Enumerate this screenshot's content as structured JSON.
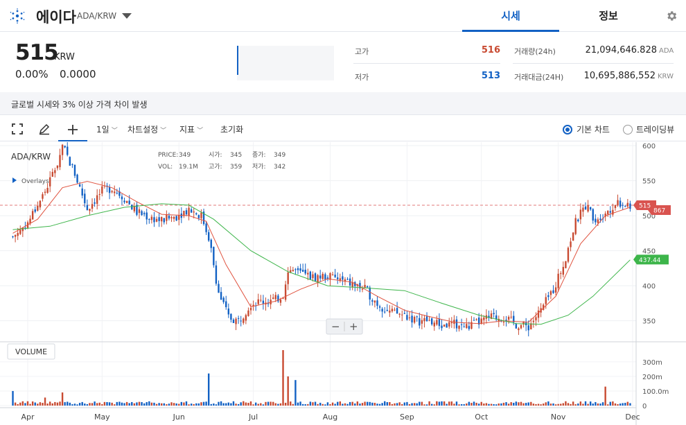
{
  "header": {
    "coin_name": "에이다",
    "pair": "ADA/KRW",
    "tabs": [
      {
        "label": "시세",
        "active": true
      },
      {
        "label": "정보",
        "active": false
      }
    ]
  },
  "summary": {
    "price": "515",
    "unit": "KRW",
    "change_pct": "0.00%",
    "change_abs": "0.0000",
    "high_label": "고가",
    "high_value": "516",
    "low_label": "저가",
    "low_value": "513",
    "volume_label": "거래량(24h)",
    "volume_value": "21,094,646.828",
    "volume_unit": "ADA",
    "turnover_label": "거래대금(24H)",
    "turnover_value": "10,695,886,552",
    "turnover_unit": "KRW",
    "colors": {
      "up": "#c84a31",
      "down": "#1261c4"
    }
  },
  "notice": "글로벌 시세와 3% 이상 가격 차이 발생",
  "toolbar": {
    "interval": "1일",
    "chart_settings": "차트설정",
    "indicators": "지표",
    "reset": "초기화",
    "basic_chart": "기본 차트",
    "tradingview": "트레이딩뷰"
  },
  "chart_info": {
    "symbol": "ADA/KRW",
    "overlays": "Overlays",
    "price_label": "PRICE:",
    "price_value": "349",
    "open_label": "시가:",
    "open_value": "345",
    "close_label": "종가:",
    "close_value": "349",
    "vol_label": "VOL:",
    "vol_value": "19.1M",
    "high_label": "고가:",
    "high_value": "359",
    "low_label": "저가:",
    "low_value": "342",
    "volume_title": "VOLUME",
    "zoom_out": "−",
    "zoom_in": "+"
  },
  "chart_data": {
    "type": "candlestick",
    "x_ticks": [
      "Apr",
      "May",
      "Jun",
      "Jul",
      "Aug",
      "Sep",
      "Oct",
      "Nov",
      "Dec"
    ],
    "y_ticks": [
      "600",
      "550",
      "500",
      "450",
      "400",
      "350"
    ],
    "ylim": [
      320,
      605
    ],
    "volume_ticks": [
      "300m",
      "200m",
      "100.0m",
      "0"
    ],
    "volume_ylim": [
      0,
      380
    ],
    "price_markers": [
      {
        "label": "515",
        "value": 515,
        "color": "#d9534f"
      },
      {
        "label": "867",
        "value": 508,
        "color": "#d9534f"
      },
      {
        "label": "437.44",
        "value": 437.44,
        "color": "#3db54a"
      }
    ],
    "reference_line": 515,
    "close_points": [
      [
        "Mar 26",
        470
      ],
      [
        "Apr 1",
        490
      ],
      [
        "Apr 8",
        535
      ],
      [
        "Apr 13",
        575
      ],
      [
        "Apr 15",
        600
      ],
      [
        "Apr 20",
        560
      ],
      [
        "Apr 25",
        510
      ],
      [
        "May 1",
        535
      ],
      [
        "May 5",
        540
      ],
      [
        "May 10",
        525
      ],
      [
        "May 15",
        505
      ],
      [
        "May 20",
        498
      ],
      [
        "May 25",
        493
      ],
      [
        "May 31",
        500
      ],
      [
        "Jun 5",
        510
      ],
      [
        "Jun 10",
        500
      ],
      [
        "Jun 13",
        470
      ],
      [
        "Jun 17",
        390
      ],
      [
        "Jun 21",
        355
      ],
      [
        "Jun 25",
        350
      ],
      [
        "Jun 30",
        375
      ],
      [
        "Jul 5",
        378
      ],
      [
        "Jul 10",
        380
      ],
      [
        "Jul 13",
        388
      ],
      [
        "Jul 15",
        425
      ],
      [
        "Jul 20",
        418
      ],
      [
        "Jul 25",
        412
      ],
      [
        "Jul 31",
        414
      ],
      [
        "Aug 5",
        408
      ],
      [
        "Aug 10",
        402
      ],
      [
        "Aug 15",
        395
      ],
      [
        "Aug 20",
        375
      ],
      [
        "Aug 25",
        362
      ],
      [
        "Aug 31",
        358
      ],
      [
        "Sep 5",
        350
      ],
      [
        "Sep 10",
        350
      ],
      [
        "Sep 15",
        343
      ],
      [
        "Sep 20",
        345
      ],
      [
        "Sep 25",
        341
      ],
      [
        "Sep 30",
        348
      ],
      [
        "Oct 5",
        355
      ],
      [
        "Oct 10",
        355
      ],
      [
        "Oct 15",
        345
      ],
      [
        "Oct 20",
        342
      ],
      [
        "Oct 25",
        365
      ],
      [
        "Oct 30",
        395
      ],
      [
        "Nov 3",
        430
      ],
      [
        "Nov 8",
        490
      ],
      [
        "Nov 12",
        515
      ],
      [
        "Nov 16",
        495
      ],
      [
        "Nov 20",
        505
      ],
      [
        "Nov 25",
        520
      ],
      [
        "Nov 30",
        515
      ]
    ],
    "ma_short": [
      [
        "Mar 26",
        475
      ],
      [
        "Apr 5",
        495
      ],
      [
        "Apr 15",
        540
      ],
      [
        "Apr 25",
        549
      ],
      [
        "May 5",
        540
      ],
      [
        "May 15",
        520
      ],
      [
        "May 25",
        502
      ],
      [
        "Jun 5",
        500
      ],
      [
        "Jun 12",
        492
      ],
      [
        "Jun 20",
        430
      ],
      [
        "Jun 30",
        370
      ],
      [
        "Jul 10",
        378
      ],
      [
        "Jul 20",
        395
      ],
      [
        "Jul 31",
        410
      ],
      [
        "Aug 10",
        405
      ],
      [
        "Aug 20",
        385
      ],
      [
        "Aug 31",
        365
      ],
      [
        "Sep 10",
        356
      ],
      [
        "Sep 20",
        348
      ],
      [
        "Sep 30",
        346
      ],
      [
        "Oct 10",
        350
      ],
      [
        "Oct 20",
        348
      ],
      [
        "Oct 31",
        385
      ],
      [
        "Nov 10",
        460
      ],
      [
        "Nov 20",
        500
      ],
      [
        "Nov 30",
        512
      ]
    ],
    "ma_long": [
      [
        "Mar 26",
        480
      ],
      [
        "Apr 10",
        485
      ],
      [
        "Apr 25",
        500
      ],
      [
        "May 10",
        512
      ],
      [
        "May 25",
        517
      ],
      [
        "Jun 5",
        515
      ],
      [
        "Jun 15",
        495
      ],
      [
        "Jun 30",
        450
      ],
      [
        "Jul 15",
        420
      ],
      [
        "Jul 31",
        400
      ],
      [
        "Aug 15",
        397
      ],
      [
        "Aug 31",
        393
      ],
      [
        "Sep 15",
        375
      ],
      [
        "Sep 30",
        358
      ],
      [
        "Oct 15",
        346
      ],
      [
        "Oct 25",
        345
      ],
      [
        "Nov 5",
        358
      ],
      [
        "Nov 15",
        385
      ],
      [
        "Nov 30",
        437
      ]
    ],
    "volume_spikes": [
      [
        "Mar 26",
        100
      ],
      [
        "Apr 8",
        55
      ],
      [
        "Apr 15",
        90
      ],
      [
        "Jun 13",
        220
      ],
      [
        "Jul 13",
        380
      ],
      [
        "Jul 15",
        200
      ],
      [
        "Jul 18",
        175
      ],
      [
        "Nov 20",
        130
      ]
    ]
  }
}
